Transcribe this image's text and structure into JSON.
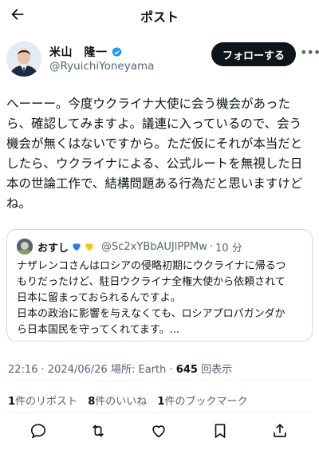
{
  "header": {
    "title": "ポスト",
    "back_icon": "back-arrow-icon"
  },
  "author": {
    "name": "米山　隆一",
    "handle": "@RyuichiYoneyama",
    "verified_icon": "verified-badge-icon",
    "verified_color": "#1d9bf0",
    "follow_label": "フォローする",
    "more_label": "•••"
  },
  "post": {
    "lines": [
      "へーーー。今度ウクライナ大使に会う機会があった",
      "ら、確認してみますよ。議連に入っているので、会う",
      "機会が無くはないですから。ただ仮にそれが本当だと",
      "したら、ウクライナによる、公式ルートを無視した日",
      "本の世論工作で、結構問題ある行為だと思いますけど",
      "ね。"
    ]
  },
  "quote": {
    "name": "おすし",
    "emoji": [
      "blue-heart-icon",
      "yellow-heart-icon"
    ],
    "handle": "@Sc2xYBbAUJlPPMw",
    "separator": "·",
    "time": "10 分",
    "lines": [
      "ナザレンコさんはロシアの侵略初期にウクライナに帰るつ",
      "もりだったけど、駐日ウクライナ全権大使から依頼されて",
      "日本に留まっておられるんですよ。",
      "日本の政治に影響を与えなくても、ロシアプロパガンダか",
      "ら日本国民を守ってくれてます。..."
    ]
  },
  "meta": {
    "time": "22:16",
    "date": "2024/06/26",
    "location_label": "場所:",
    "location": "Earth",
    "views": "645",
    "views_label": "回表示",
    "dot": "·"
  },
  "stats": [
    {
      "num": "1",
      "label": "件のリポスト"
    },
    {
      "num": "8",
      "label": "件のいいね"
    },
    {
      "num": "1",
      "label": "件のブックマーク"
    }
  ],
  "actions": [
    "reply-icon",
    "repost-icon",
    "like-icon",
    "bookmark-icon",
    "share-icon"
  ]
}
